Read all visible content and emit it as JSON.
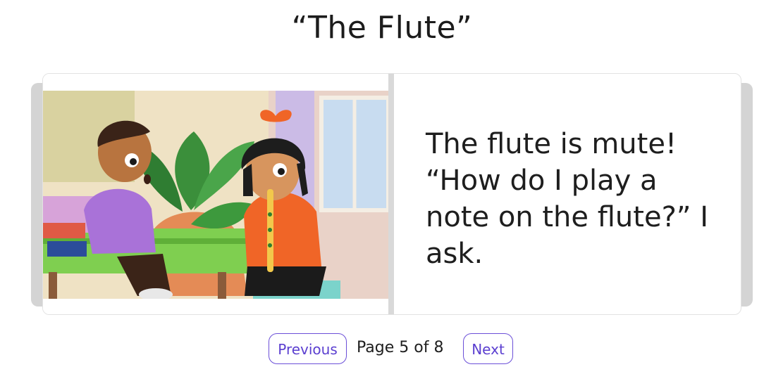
{
  "story": {
    "title": "“The Flute”"
  },
  "page": {
    "text_lines": [
      "The flute is mute!",
      "“How do I play a",
      "note on the flute?” I",
      "ask."
    ],
    "illustration_name": "boy-and-girl-with-flute-illustration"
  },
  "nav": {
    "previous_label": "Previous",
    "next_label": "Next",
    "page_indicator": "Page 5 of 8"
  }
}
